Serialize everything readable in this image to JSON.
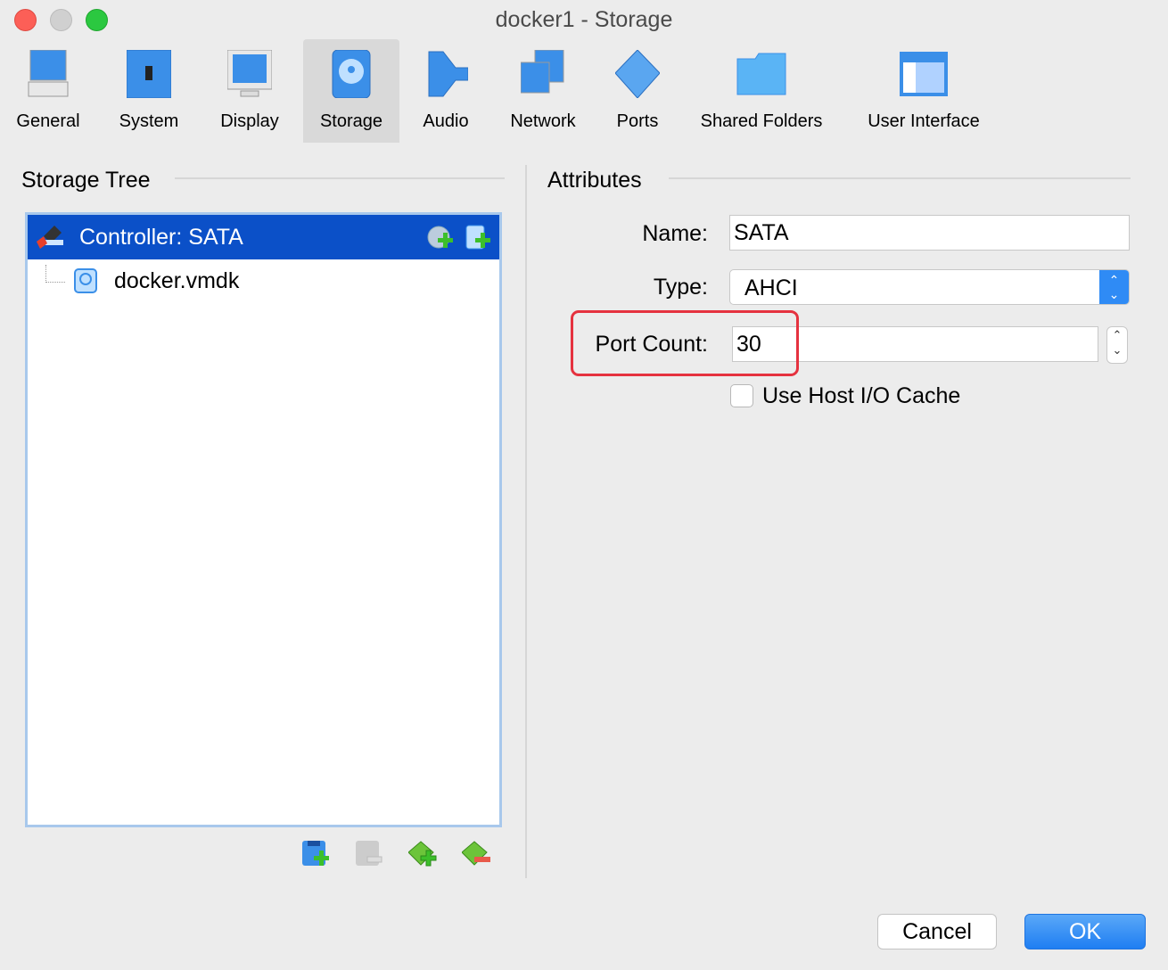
{
  "window": {
    "title": "docker1 - Storage"
  },
  "toolbar": [
    {
      "label": "General",
      "icon": "general-monitor-icon"
    },
    {
      "label": "System",
      "icon": "system-chip-icon"
    },
    {
      "label": "Display",
      "icon": "display-icon"
    },
    {
      "label": "Storage",
      "icon": "storage-disk-icon",
      "selected": true
    },
    {
      "label": "Audio",
      "icon": "speaker-icon"
    },
    {
      "label": "Network",
      "icon": "network-icon"
    },
    {
      "label": "Ports",
      "icon": "ports-icon"
    },
    {
      "label": "Shared Folders",
      "icon": "folder-icon"
    },
    {
      "label": "User Interface",
      "icon": "user-interface-icon"
    }
  ],
  "storage_tree": {
    "heading": "Storage Tree",
    "controller": "Controller: SATA",
    "children": [
      "docker.vmdk"
    ]
  },
  "attributes": {
    "heading": "Attributes",
    "name_label": "Name:",
    "name_value": "SATA",
    "type_label": "Type:",
    "type_value": "AHCI",
    "port_count_label": "Port Count:",
    "port_count_value": "30",
    "host_cache_label": "Use Host I/O Cache",
    "host_cache_checked": false
  },
  "buttons": {
    "cancel": "Cancel",
    "ok": "OK"
  },
  "colors": {
    "selection": "#0b50c8",
    "highlight": "#e5323f",
    "ok": "#2f8bf5"
  }
}
